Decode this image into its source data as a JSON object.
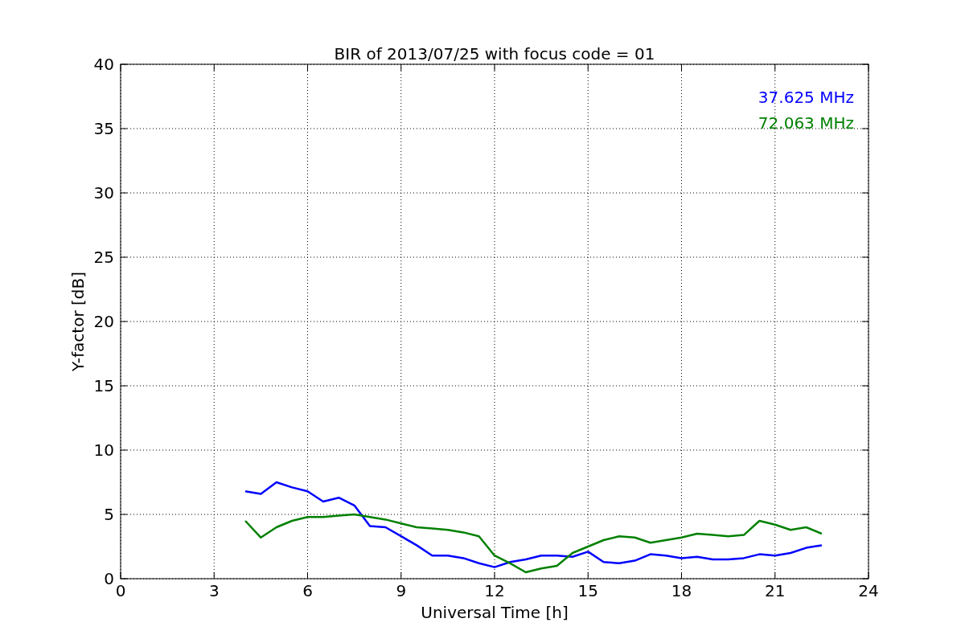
{
  "chart_data": {
    "type": "line",
    "title": "BIR of 2013/07/25 with focus code = 01",
    "xlabel": "Universal Time [h]",
    "ylabel": "Y-factor [dB]",
    "x": [
      4,
      4.5,
      5,
      5.5,
      6,
      6.5,
      7,
      7.5,
      8,
      8.5,
      9,
      9.5,
      10,
      10.5,
      11,
      11.5,
      12,
      12.5,
      13,
      13.5,
      14,
      14.5,
      15,
      15.5,
      16,
      16.5,
      17,
      17.5,
      18,
      18.5,
      19,
      19.5,
      20,
      20.5,
      21,
      21.5,
      22,
      22.5
    ],
    "series": [
      {
        "name": "37.625 MHz",
        "color": "#0000ff",
        "values": [
          6.8,
          6.6,
          7.5,
          7.1,
          6.8,
          6.0,
          6.3,
          5.7,
          4.1,
          4.0,
          3.3,
          2.6,
          1.8,
          1.8,
          1.6,
          1.2,
          0.9,
          1.3,
          1.5,
          1.8,
          1.8,
          1.7,
          2.1,
          1.3,
          1.2,
          1.4,
          1.9,
          1.8,
          1.6,
          1.7,
          1.5,
          1.5,
          1.6,
          1.9,
          1.8,
          2.0,
          2.4,
          2.6
        ]
      },
      {
        "name": "72.063 MHz",
        "color": "#008000",
        "values": [
          4.5,
          3.2,
          4.0,
          4.5,
          4.8,
          4.8,
          4.9,
          5.0,
          4.8,
          4.6,
          4.3,
          4.0,
          3.9,
          3.8,
          3.6,
          3.3,
          1.8,
          1.2,
          0.5,
          0.8,
          1.0,
          2.0,
          2.5,
          3.0,
          3.3,
          3.2,
          2.8,
          3.0,
          3.2,
          3.5,
          3.4,
          3.3,
          3.4,
          4.5,
          4.2,
          3.8,
          4.0,
          3.5
        ]
      }
    ],
    "grid": true,
    "xlim": [
      0,
      24
    ],
    "ylim": [
      0,
      40
    ],
    "xticks": [
      0,
      3,
      6,
      9,
      12,
      15,
      18,
      21,
      24
    ],
    "yticks": [
      0,
      5,
      10,
      15,
      20,
      25,
      30,
      35,
      40
    ]
  }
}
